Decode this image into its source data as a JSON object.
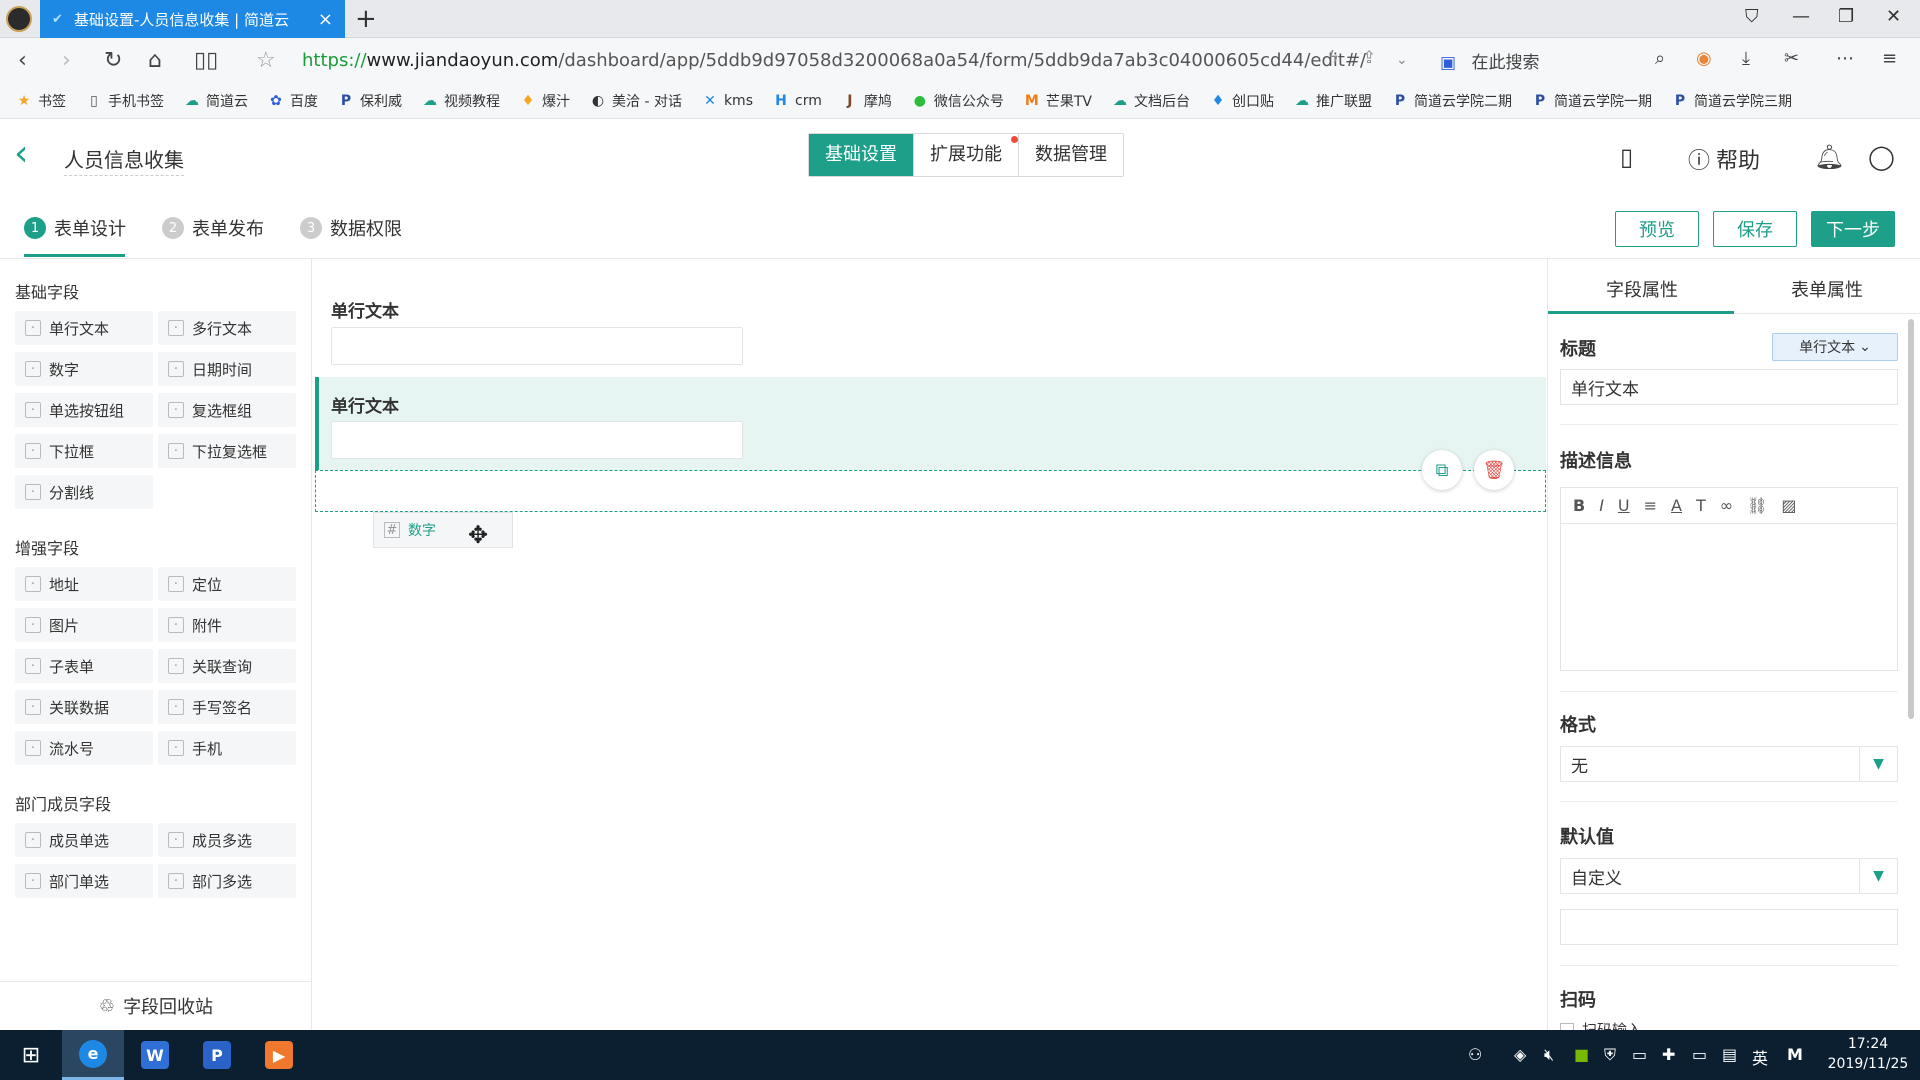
{
  "browser": {
    "tab_title": "基础设置-人员信息收集 | 简道云",
    "url_scheme": "https://",
    "url_host": "www.jiandaoyun.com",
    "url_path": "/dashboard/app/5ddb9d97058d3200068a0a54/form/5ddb9da7ab3c04000605cd44/edit#/",
    "search_placeholder": "在此搜索",
    "bookmarks": [
      {
        "label": "书签",
        "icon": "star-icon",
        "color": "#f5a623"
      },
      {
        "label": "手机书签",
        "icon": "phone-icon",
        "color": "#555"
      },
      {
        "label": "简道云",
        "icon": "cloud-icon",
        "color": "#1d9f89"
      },
      {
        "label": "百度",
        "icon": "paw-icon",
        "color": "#2e5fd8"
      },
      {
        "label": "保利威",
        "icon": "p-icon",
        "color": "#2b4ea2"
      },
      {
        "label": "视频教程",
        "icon": "cloud-icon",
        "color": "#1d9f89"
      },
      {
        "label": "爆汁",
        "icon": "drop-icon",
        "color": "#f5a623"
      },
      {
        "label": "美洽 - 对话",
        "icon": "chat-icon",
        "color": "#333"
      },
      {
        "label": "kms",
        "icon": "x-icon",
        "color": "#1e88e5"
      },
      {
        "label": "crm",
        "icon": "h-icon",
        "color": "#1e88e5"
      },
      {
        "label": "摩鸠",
        "icon": "j-icon",
        "color": "#7a4b2a"
      },
      {
        "label": "微信公众号",
        "icon": "wechat-icon",
        "color": "#2dbb3e"
      },
      {
        "label": "芒果TV",
        "icon": "tv-icon",
        "color": "#ef7d1a"
      },
      {
        "label": "文档后台",
        "icon": "cloud-icon",
        "color": "#1d9f89"
      },
      {
        "label": "创口贴",
        "icon": "drop-icon",
        "color": "#1e88e5"
      },
      {
        "label": "推广联盟",
        "icon": "cloud-icon",
        "color": "#1d9f89"
      },
      {
        "label": "简道云学院二期",
        "icon": "p-icon",
        "color": "#2b4ea2"
      },
      {
        "label": "简道云学院一期",
        "icon": "p-icon",
        "color": "#2b4ea2"
      },
      {
        "label": "简道云学院三期",
        "icon": "p-icon",
        "color": "#2b4ea2"
      }
    ]
  },
  "app": {
    "name": "人员信息收集",
    "nav": [
      "基础设置",
      "扩展功能",
      "数据管理"
    ],
    "help": "帮助",
    "steps": [
      {
        "num": "1",
        "label": "表单设计"
      },
      {
        "num": "2",
        "label": "表单发布"
      },
      {
        "num": "3",
        "label": "数据权限"
      }
    ],
    "buttons": {
      "preview": "预览",
      "save": "保存",
      "next": "下一步"
    }
  },
  "left": {
    "basic_title": "基础字段",
    "basic": [
      "单行文本",
      "多行文本",
      "数字",
      "日期时间",
      "单选按钮组",
      "复选框组",
      "下拉框",
      "下拉复选框",
      "分割线"
    ],
    "enhanced_title": "增强字段",
    "enhanced": [
      "地址",
      "定位",
      "图片",
      "附件",
      "子表单",
      "关联查询",
      "关联数据",
      "手写签名",
      "流水号",
      "手机"
    ],
    "member_title": "部门成员字段",
    "member": [
      "成员单选",
      "成员多选",
      "部门单选",
      "部门多选"
    ],
    "recycle": "字段回收站"
  },
  "canvas": {
    "field1_label": "单行文本",
    "field2_label": "单行文本",
    "drag_label": "数字"
  },
  "right": {
    "tabs": [
      "字段属性",
      "表单属性"
    ],
    "title_label": "标题",
    "type_button": "单行文本",
    "title_value": "单行文本",
    "desc_label": "描述信息",
    "format_label": "格式",
    "format_value": "无",
    "default_label": "默认值",
    "default_value": "自定义",
    "scan_label": "扫码",
    "scan_option": "扫码输入"
  },
  "taskbar": {
    "time": "17:24",
    "date": "2019/11/25",
    "ime": "英"
  }
}
